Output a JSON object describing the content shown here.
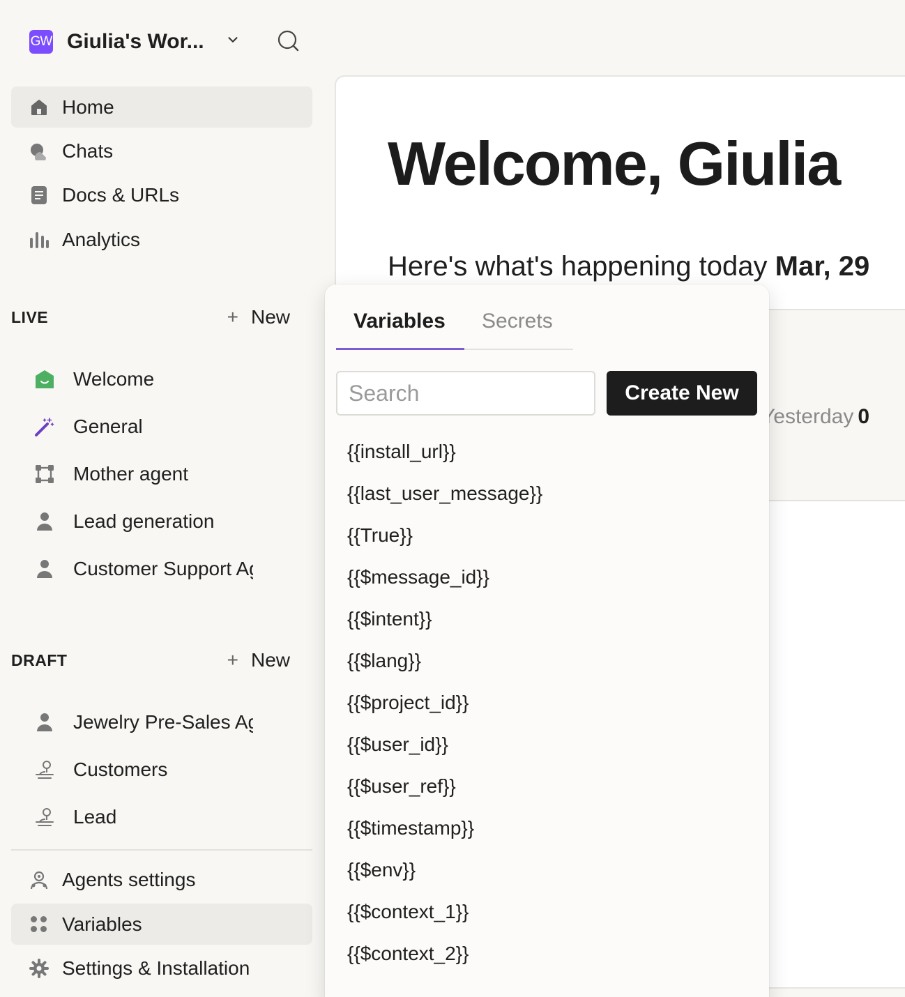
{
  "workspace": {
    "logo_text": "GW",
    "name": "Giulia's Wor..."
  },
  "nav": [
    {
      "label": "Home",
      "icon": "home-icon",
      "active": true
    },
    {
      "label": "Chats",
      "icon": "chats-icon"
    },
    {
      "label": "Docs & URLs",
      "icon": "doc-icon"
    },
    {
      "label": "Analytics",
      "icon": "analytics-icon"
    }
  ],
  "live": {
    "title": "LIVE",
    "new_label": "New",
    "items": [
      {
        "label": "Welcome",
        "icon": "welcome-agent-icon"
      },
      {
        "label": "General",
        "icon": "magic-wand-icon"
      },
      {
        "label": "Mother agent",
        "icon": "frame-icon"
      },
      {
        "label": "Lead generation",
        "icon": "person-icon"
      },
      {
        "label": "Customer Support Agent",
        "icon": "person-icon"
      }
    ]
  },
  "draft": {
    "title": "DRAFT",
    "new_label": "New",
    "items": [
      {
        "label": "Jewelry Pre-Sales Agent",
        "icon": "person-icon"
      },
      {
        "label": "Customers",
        "icon": "user-location-icon"
      },
      {
        "label": "Lead",
        "icon": "user-location-icon"
      }
    ]
  },
  "bottom_nav": [
    {
      "label": "Agents settings",
      "icon": "agents-settings-icon"
    },
    {
      "label": "Variables",
      "icon": "variables-icon",
      "active": true
    },
    {
      "label": "Settings & Installation",
      "icon": "gear-icon"
    }
  ],
  "main": {
    "welcome": "Welcome, Giulia",
    "subtitle_prefix": "Here's what's happening today ",
    "subtitle_date": "Mar, 29",
    "stat_label": "Yesterday",
    "stat_value": "0"
  },
  "popover": {
    "tabs": [
      "Variables",
      "Secrets"
    ],
    "search_placeholder": "Search",
    "create_label": "Create New",
    "variables": [
      "{{install_url}}",
      "{{last_user_message}}",
      "{{True}}",
      "{{$message_id}}",
      "{{$intent}}",
      "{{$lang}}",
      "{{$project_id}}",
      "{{$user_id}}",
      "{{$user_ref}}",
      "{{$timestamp}}",
      "{{$env}}",
      "{{$context_1}}",
      "{{$context_2}}"
    ]
  }
}
